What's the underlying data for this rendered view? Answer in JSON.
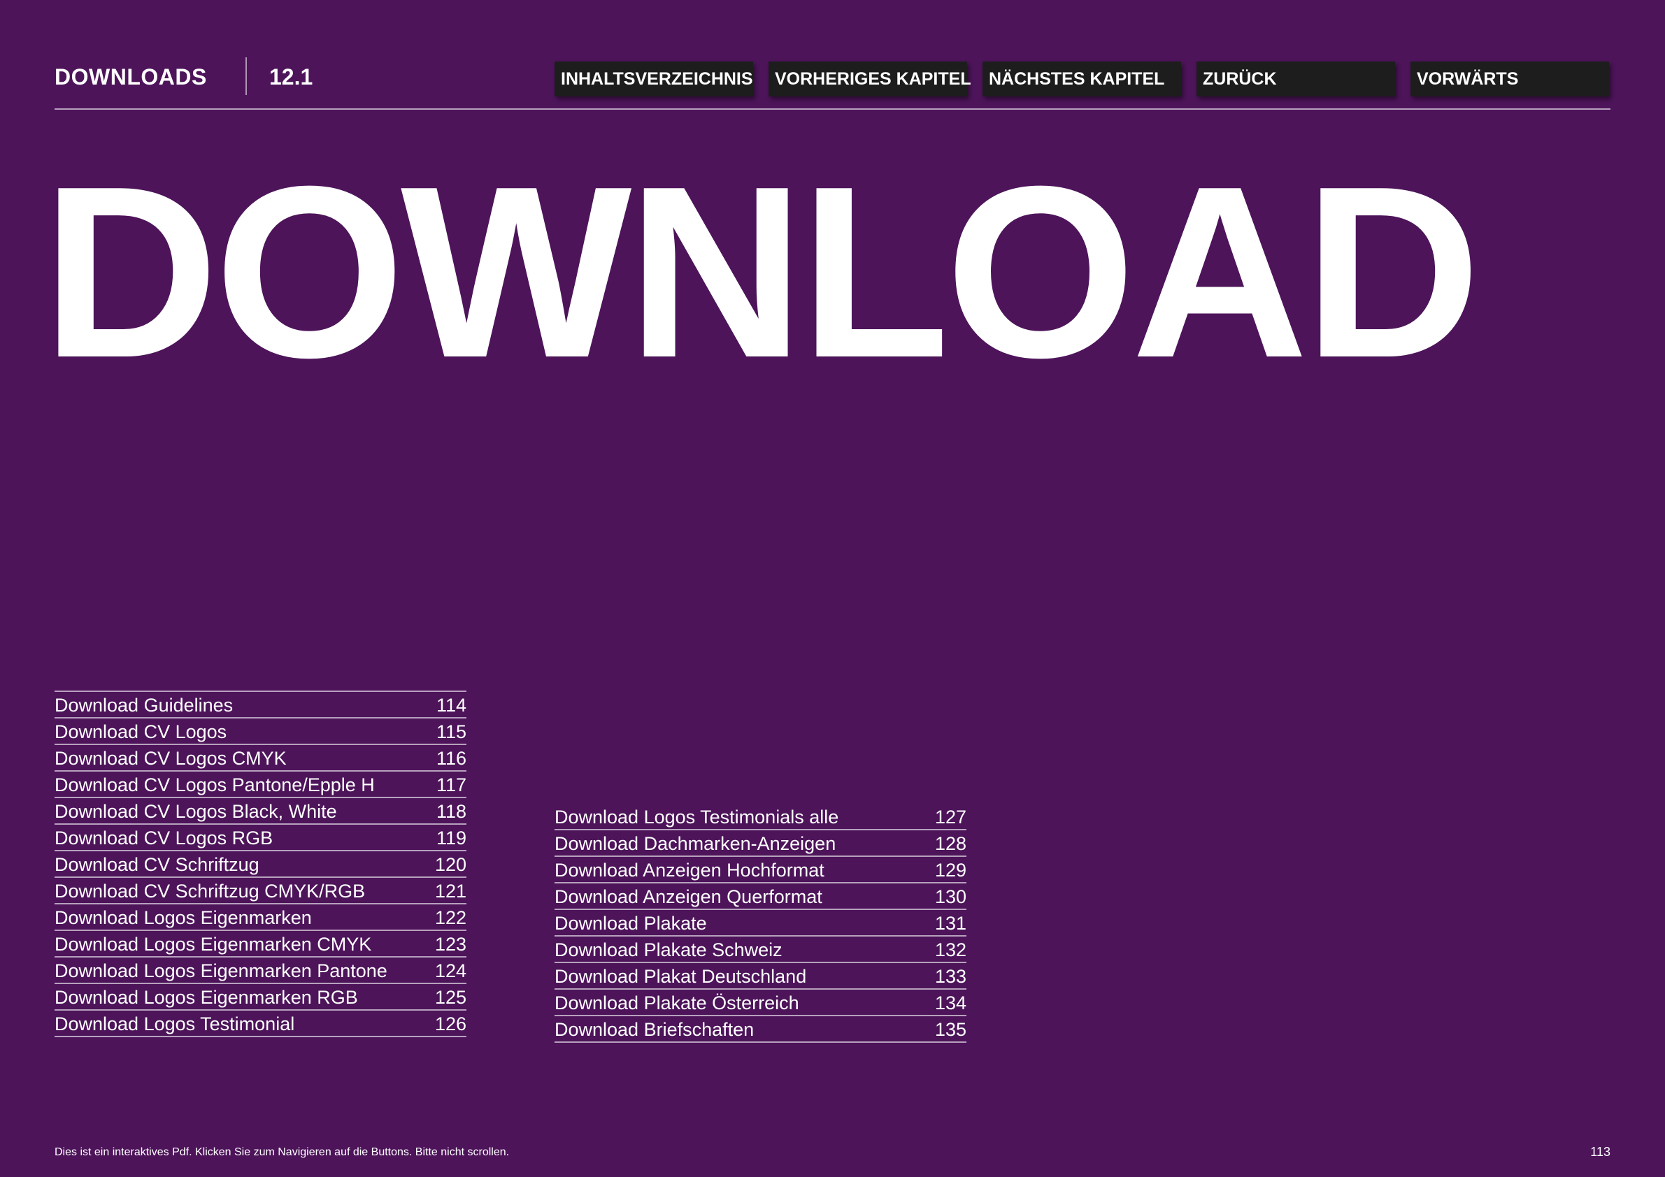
{
  "header": {
    "section_title": "DOWNLOADS",
    "section_number": "12.1",
    "nav": [
      {
        "label": "INHALTSVERZEICHNIS"
      },
      {
        "label": "VORHERIGES KAPITEL"
      },
      {
        "label": "NÄCHSTES KAPITEL"
      },
      {
        "label": "ZURÜCK"
      },
      {
        "label": "VORWÄRTS"
      }
    ]
  },
  "hero_title": "DOWNLOAD",
  "toc": {
    "left": [
      {
        "label": "Download Guidelines",
        "page": "114"
      },
      {
        "label": "Download CV Logos",
        "page": "115"
      },
      {
        "label": "Download CV Logos CMYK",
        "page": "116"
      },
      {
        "label": "Download CV Logos Pantone/Epple H",
        "page": "117"
      },
      {
        "label": "Download CV Logos Black, White",
        "page": "118"
      },
      {
        "label": "Download CV Logos RGB",
        "page": "119"
      },
      {
        "label": "Download CV Schriftzug",
        "page": "120"
      },
      {
        "label": "Download CV Schriftzug CMYK/RGB",
        "page": "121"
      },
      {
        "label": "Download Logos Eigenmarken",
        "page": "122"
      },
      {
        "label": "Download Logos Eigenmarken CMYK",
        "page": "123"
      },
      {
        "label": "Download Logos Eigenmarken Pantone",
        "page": "124"
      },
      {
        "label": "Download Logos Eigenmarken RGB",
        "page": "125"
      },
      {
        "label": "Download Logos Testimonial",
        "page": "126"
      }
    ],
    "right": [
      {
        "label": "Download Logos Testimonials alle",
        "page": "127"
      },
      {
        "label": "Download Dachmarken-Anzeigen",
        "page": "128"
      },
      {
        "label": "Download Anzeigen Hochformat",
        "page": "129"
      },
      {
        "label": "Download Anzeigen Querformat",
        "page": "130"
      },
      {
        "label": "Download Plakate",
        "page": "131"
      },
      {
        "label": "Download Plakate Schweiz",
        "page": "132"
      },
      {
        "label": "Download Plakat Deutschland",
        "page": "133"
      },
      {
        "label": "Download Plakate Österreich",
        "page": "134"
      },
      {
        "label": "Download Briefschaften",
        "page": "135"
      }
    ]
  },
  "footer": {
    "note": "Dies ist ein interaktives Pdf. Klicken Sie zum Navigieren auf die Buttons. Bitte nicht scrollen.",
    "page_number": "113"
  },
  "colors": {
    "background": "#4d145a",
    "button": "#1d1d1d",
    "text": "#ffffff"
  }
}
